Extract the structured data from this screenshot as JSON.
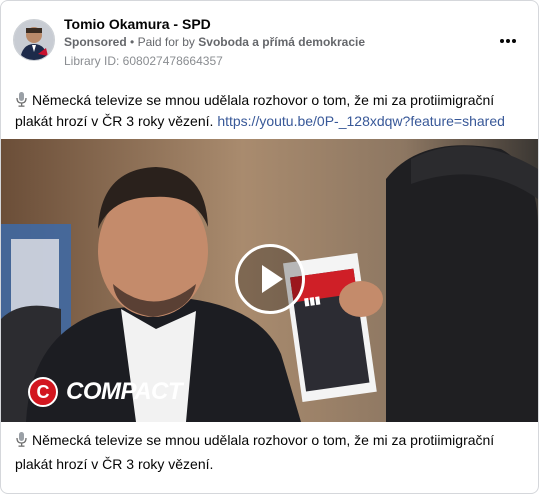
{
  "post": {
    "page_name": "Tomio Okamura - SPD",
    "sponsored_label": "Sponsored",
    "paid_for_prefix": "Paid for by",
    "payer": "Svoboda a přímá demokracie",
    "library_id": "Library ID: 608027478664357",
    "body_text": "Německá televize se mnou udělala rozhovor o tom, že mi za protiimigrační plakát hrozí v ČR 3 roky vězení.",
    "body_link": "https://youtu.be/0P-_128xdqw?feature=shared"
  },
  "media": {
    "type": "video",
    "watermark": "COMPACT",
    "watermark_letter": "C",
    "play_icon": "play-icon"
  },
  "caption": {
    "text": "Německá televize se mnou udělala rozhovor o tom, že mi za protiimigrační plakát hrozí v ČR 3 roky vězení."
  },
  "icons": {
    "mic": "microphone-icon",
    "more": "more-options-icon"
  },
  "colors": {
    "link": "#385898",
    "secondary_text": "#65676b",
    "compact_red": "#d2161f"
  }
}
